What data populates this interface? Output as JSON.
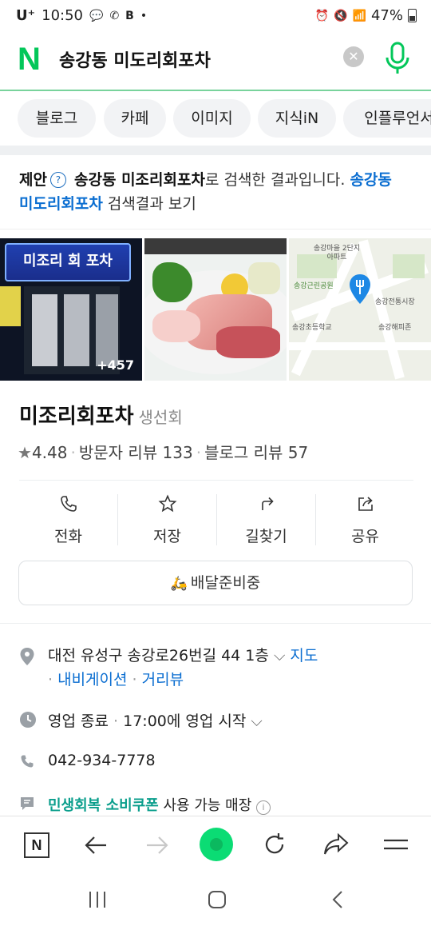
{
  "status": {
    "carrier": "U⁺",
    "time": "10:50",
    "battery": "47%"
  },
  "search": {
    "query": "송강동 미도리회포차",
    "clear_label": "✕"
  },
  "tabs": [
    "블로그",
    "카페",
    "이미지",
    "지식iN",
    "인플루언서"
  ],
  "suggestion": {
    "prefix": "제안",
    "corrected": "송강동 미조리회포차",
    "mid": "로 검색한 결과입니다.",
    "original": "송강동 미도리회포차",
    "suffix": " 검색결과 보기"
  },
  "photos": {
    "sign_text": "미조리 회 포차",
    "count_badge": "+457",
    "map_labels": [
      "송강마을 2단지아파트",
      "송강근린공원",
      "송강전통시장",
      "송강해피존",
      "송강초등학교"
    ]
  },
  "place": {
    "name": "미조리회포차",
    "category": "생선회",
    "rating": "4.48",
    "visitor_reviews": "방문자 리뷰 133",
    "blog_reviews": "블로그 리뷰 57"
  },
  "actions": [
    "전화",
    "저장",
    "길찾기",
    "공유"
  ],
  "delivery_label": "배달준비중",
  "info": {
    "address": "대전 유성구 송강로26번길 44 1층",
    "map_link": "지도",
    "navigation_link": "내비게이션",
    "streetview_link": "거리뷰",
    "hours_status": "영업 종료",
    "hours_detail": "17:00에 영업 시작",
    "phone": "042-934-7778",
    "coupon_link": "민생회복 소비쿠폰",
    "coupon_text": "사용 가능 매장"
  },
  "colors": {
    "brand": "#03c75a",
    "link": "#0b6ed1"
  }
}
